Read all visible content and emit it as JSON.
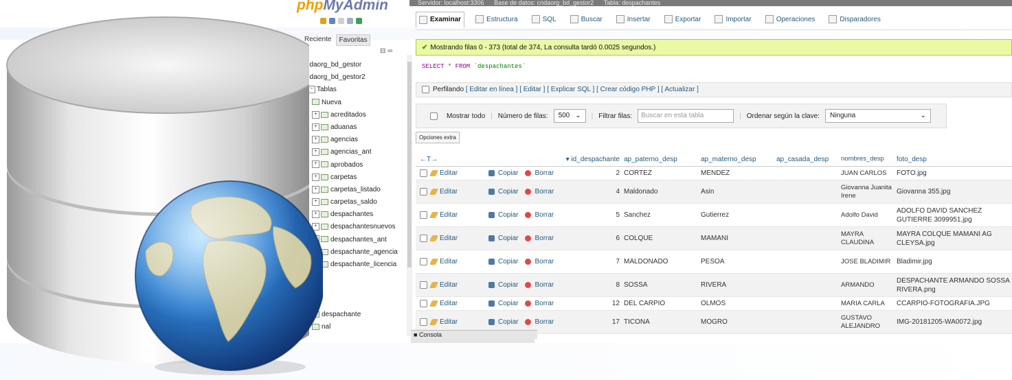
{
  "pma": {
    "logo_php": "php",
    "logo_myadmin": "MyAdmin",
    "nav_tabs": [
      "Reciente",
      "Favoritas"
    ],
    "collapse_label": "⊟ ∞",
    "tree": [
      {
        "label": "cndaorg_bd_gestor",
        "expander": ""
      },
      {
        "label": "cndaorg_bd_gestor2",
        "expander": ""
      },
      {
        "label": "Tablas",
        "expander": "−"
      },
      {
        "label": "Nueva",
        "expander": ""
      },
      {
        "label": "acreditados",
        "expander": "+"
      },
      {
        "label": "aduanas",
        "expander": "+"
      },
      {
        "label": "agencias",
        "expander": "+"
      },
      {
        "label": "agencias_ant",
        "expander": "+"
      },
      {
        "label": "aprobados",
        "expander": "+"
      },
      {
        "label": "carpetas",
        "expander": "+"
      },
      {
        "label": "carpetas_listado",
        "expander": "+"
      },
      {
        "label": "carpetas_saldo",
        "expander": "+"
      },
      {
        "label": "despachantes",
        "expander": "+"
      },
      {
        "label": "despachantesnuevos",
        "expander": "+"
      },
      {
        "label": "despachantes_ant",
        "expander": "+"
      },
      {
        "label": "despachante_agencia",
        "expander": "+"
      },
      {
        "label": "despachante_licencia",
        "expander": "+"
      },
      {
        "label": "",
        "expander": ""
      },
      {
        "label": "",
        "expander": ""
      },
      {
        "label": "",
        "expander": ""
      },
      {
        "label": "despachante",
        "expander": ""
      },
      {
        "label": "nal",
        "expander": ""
      }
    ]
  },
  "breadcrumb": [
    "Servidor: localhost:3306",
    "Base de datos: cndaorg_bd_gestor2",
    "Tabla: despachantes"
  ],
  "tabs": [
    "Examinar",
    "Estructura",
    "SQL",
    "Buscar",
    "Insertar",
    "Exportar",
    "Importar",
    "Operaciones",
    "Disparadores"
  ],
  "success_message": "Mostrando filas 0 - 373 (total de 374, La consulta tardó 0.0025 segundos.)",
  "sql": {
    "select": "SELECT",
    "star": " * ",
    "from": "FROM",
    "table": " `despachantes`"
  },
  "profiling": {
    "label": "Perfilando",
    "links": "[ Editar en línea ] [ Editar ] [ Explicar SQL ] [ Crear código PHP ] [ Actualizar ]"
  },
  "filters": {
    "show_all": "Mostrar todo",
    "rows_label": "Número de filas:",
    "rows_value": "500",
    "filter_label": "Filtrar filas:",
    "filter_placeholder": "Buscar en esta tabla",
    "sort_label": "Ordenar según la clave:",
    "sort_value": "Ninguna"
  },
  "extra_options": "Opciones extra",
  "columns": {
    "arrows": "←T→",
    "id": "▾ id_despachante",
    "paterno": "ap_paterno_desp",
    "materno": "ap_materno_desp",
    "casada": "ap_casada_desp",
    "nombres": "nombres_desp",
    "foto": "foto_desp"
  },
  "actions": {
    "edit": "Editar",
    "copy": "Copiar",
    "delete": "Borrar"
  },
  "rows": [
    {
      "id": "2",
      "paterno": "CORTEZ",
      "materno": "MENDEZ",
      "casada": "",
      "nombres": "JUAN CARLOS",
      "foto": "FOTO.jpg"
    },
    {
      "id": "4",
      "paterno": "Maldonado",
      "materno": "Asin",
      "casada": "",
      "nombres": "Giovanna Juanita Irene",
      "foto": "Giovanna 355.jpg"
    },
    {
      "id": "5",
      "paterno": "Sanchez",
      "materno": "Gutierrez",
      "casada": "",
      "nombres": "Adolfo David",
      "foto": "ADOLFO DAVID SANCHEZ GUTIERRE 3099951.jpg"
    },
    {
      "id": "6",
      "paterno": "COLQUE",
      "materno": "MAMANI",
      "casada": "",
      "nombres": "MAYRA CLAUDINA",
      "foto": "MAYRA COLQUE MAMANI AG CLEYSA.jpg"
    },
    {
      "id": "7",
      "paterno": "MALDONADO",
      "materno": "PESOA",
      "casada": "",
      "nombres": "JOSE BLADIMIR",
      "foto": "Bladimir.jpg"
    },
    {
      "id": "8",
      "paterno": "SOSSA",
      "materno": "RIVERA",
      "casada": "",
      "nombres": "ARMANDO",
      "foto": "DESPACHANTE ARMANDO SOSSA RIVERA.png"
    },
    {
      "id": "12",
      "paterno": "DEL CARPIO",
      "materno": "OLMOS",
      "casada": "",
      "nombres": "MARIA CARLA",
      "foto": "CCARPIO-FOTOGRAFIA.JPG"
    },
    {
      "id": "17",
      "paterno": "TICONA",
      "materno": "MOGRO",
      "casada": "",
      "nombres": "GUSTAVO ALEJANDRO",
      "foto": "IMG-20181205-WA0072.jpg"
    }
  ],
  "console_label": "Consola",
  "colors": {
    "accent": "#235a81",
    "success_bg": "#ebf8a4",
    "logo_orange": "#f29d00",
    "logo_blue": "#6c78af"
  }
}
